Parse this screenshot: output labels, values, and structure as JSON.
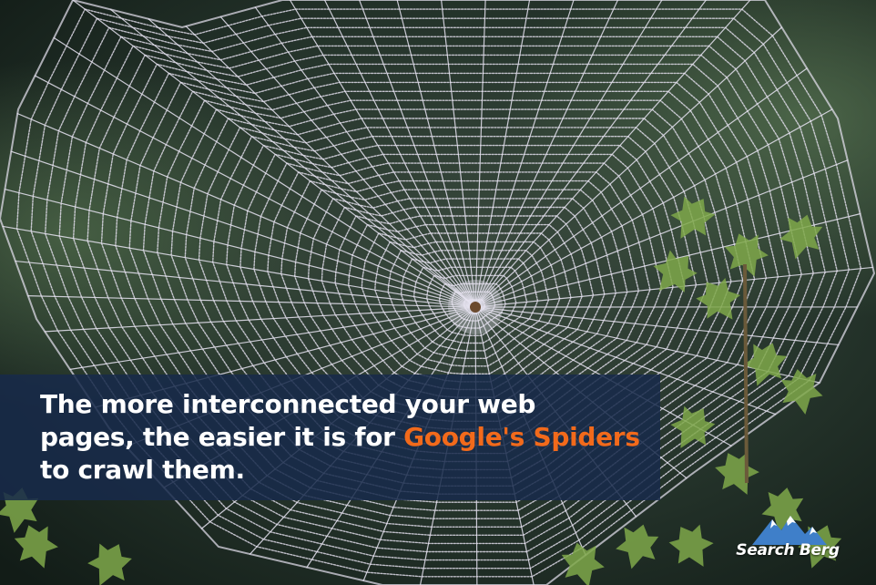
{
  "caption": {
    "line1": "The more interconnected your web",
    "line2_before": "pages, the easier it is for ",
    "line2_highlight": "Google's Spiders",
    "line3": "to crawl them."
  },
  "logo": {
    "text": "Search Berg",
    "icon": "mountain-icon"
  },
  "colors": {
    "caption_bg": "#172a4a",
    "highlight": "#f26a1b",
    "text": "#ffffff",
    "mountain": "#3f7fc9"
  }
}
